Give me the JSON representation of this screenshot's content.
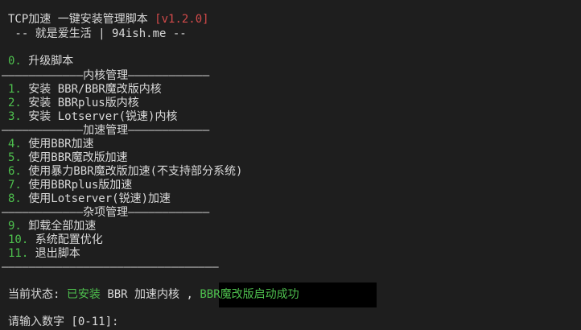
{
  "header": {
    "title": "TCP加速 一键安装管理脚本",
    "version": "[v1.2.0]",
    "subtitle": " -- 就是爱生活 | 94ish.me --"
  },
  "menu": {
    "item0": {
      "num": "0.",
      "label": "升级脚本"
    },
    "sep_kernel": "————————————内核管理————————————",
    "item1": {
      "num": "1.",
      "label": "安装 BBR/BBR魔改版内核"
    },
    "item2": {
      "num": "2.",
      "label": "安装 BBRplus版内核"
    },
    "item3": {
      "num": "3.",
      "label": "安装 Lotserver(锐速)内核"
    },
    "sep_accel": "————————————加速管理————————————",
    "item4": {
      "num": "4.",
      "label": "使用BBR加速"
    },
    "item5": {
      "num": "5.",
      "label": "使用BBR魔改版加速"
    },
    "item6": {
      "num": "6.",
      "label": "使用暴力BBR魔改版加速(不支持部分系统)"
    },
    "item7": {
      "num": "7.",
      "label": "使用BBRplus版加速"
    },
    "item8": {
      "num": "8.",
      "label": "使用Lotserver(锐速)加速"
    },
    "sep_misc": "————————————杂项管理————————————",
    "item9": {
      "num": "9.",
      "label": "卸载全部加速"
    },
    "item10": {
      "num": "10.",
      "label": "系统配置优化"
    },
    "item11": {
      "num": "11.",
      "label": "退出脚本"
    },
    "sep_end": "————————————————————————————————"
  },
  "status": {
    "label": "当前状态:",
    "installed": "已安装",
    "kernel_text": "BBR 加速内核",
    "comma": ",",
    "running": "BBR魔改版启动成功"
  },
  "prompt": {
    "text": "请输入数字 [0-11]:"
  },
  "colors": {
    "background": "#1e1e1e",
    "text": "#d9d9d9",
    "green": "#4ec04e",
    "red": "#d24a4a"
  }
}
